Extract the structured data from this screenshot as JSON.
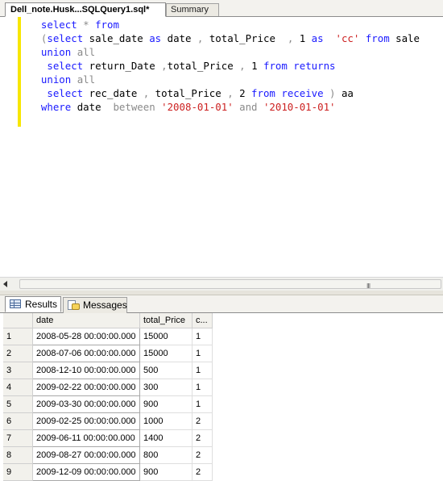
{
  "tabs": {
    "active": "Dell_note.Husk...SQLQuery1.sql*",
    "inactive": "Summary"
  },
  "editor": {
    "lines": [
      [
        {
          "c": "kw",
          "t": "  select "
        },
        {
          "c": "gr",
          "t": "* "
        },
        {
          "c": "kw",
          "t": "from"
        }
      ],
      [
        {
          "c": "gr",
          "t": "  ("
        },
        {
          "c": "kw",
          "t": "select "
        },
        {
          "c": "tx",
          "t": "sale_date "
        },
        {
          "c": "kw",
          "t": "as "
        },
        {
          "c": "tx",
          "t": "date "
        },
        {
          "c": "gr",
          "t": ", "
        },
        {
          "c": "tx",
          "t": "total_Price  "
        },
        {
          "c": "gr",
          "t": ", "
        },
        {
          "c": "tx",
          "t": "1 "
        },
        {
          "c": "kw",
          "t": "as  "
        },
        {
          "c": "st",
          "t": "'cc' "
        },
        {
          "c": "kw",
          "t": "from "
        },
        {
          "c": "tx",
          "t": "sale"
        }
      ],
      [
        {
          "c": "kw",
          "t": "  union "
        },
        {
          "c": "gr",
          "t": "all"
        }
      ],
      [
        {
          "c": "kw",
          "t": "   select "
        },
        {
          "c": "tx",
          "t": "return_Date "
        },
        {
          "c": "gr",
          "t": ","
        },
        {
          "c": "tx",
          "t": "total_Price "
        },
        {
          "c": "gr",
          "t": ", "
        },
        {
          "c": "tx",
          "t": "1 "
        },
        {
          "c": "kw",
          "t": "from "
        },
        {
          "c": "kw",
          "t": "returns"
        }
      ],
      [
        {
          "c": "kw",
          "t": "  union "
        },
        {
          "c": "gr",
          "t": "all"
        }
      ],
      [
        {
          "c": "kw",
          "t": "   select "
        },
        {
          "c": "tx",
          "t": "rec_date "
        },
        {
          "c": "gr",
          "t": ", "
        },
        {
          "c": "tx",
          "t": "total_Price "
        },
        {
          "c": "gr",
          "t": ", "
        },
        {
          "c": "tx",
          "t": "2 "
        },
        {
          "c": "kw",
          "t": "from "
        },
        {
          "c": "kw",
          "t": "receive "
        },
        {
          "c": "gr",
          "t": ") "
        },
        {
          "c": "tx",
          "t": "aa"
        }
      ],
      [
        {
          "c": "kw",
          "t": "  where "
        },
        {
          "c": "tx",
          "t": "date  "
        },
        {
          "c": "gr",
          "t": "between "
        },
        {
          "c": "st",
          "t": "'2008-01-01' "
        },
        {
          "c": "gr",
          "t": "and "
        },
        {
          "c": "st",
          "t": "'2010-01-01'"
        }
      ]
    ]
  },
  "scrollbar": {
    "grip": "III"
  },
  "results_tabs": {
    "results": "Results",
    "messages": "Messages"
  },
  "grid": {
    "columns": [
      "date",
      "total_Price",
      "c..."
    ],
    "rows": [
      [
        "1",
        "2008-05-28 00:00:00.000",
        "15000",
        "1"
      ],
      [
        "2",
        "2008-07-06 00:00:00.000",
        "15000",
        "1"
      ],
      [
        "3",
        "2008-12-10 00:00:00.000",
        "500",
        "1"
      ],
      [
        "4",
        "2009-02-22 00:00:00.000",
        "300",
        "1"
      ],
      [
        "5",
        "2009-03-30 00:00:00.000",
        "900",
        "1"
      ],
      [
        "6",
        "2009-02-25 00:00:00.000",
        "1000",
        "2"
      ],
      [
        "7",
        "2009-06-11 00:00:00.000",
        "1400",
        "2"
      ],
      [
        "8",
        "2009-08-27 00:00:00.000",
        "800",
        "2"
      ],
      [
        "9",
        "2009-12-09 00:00:00.000",
        "900",
        "2"
      ]
    ]
  }
}
